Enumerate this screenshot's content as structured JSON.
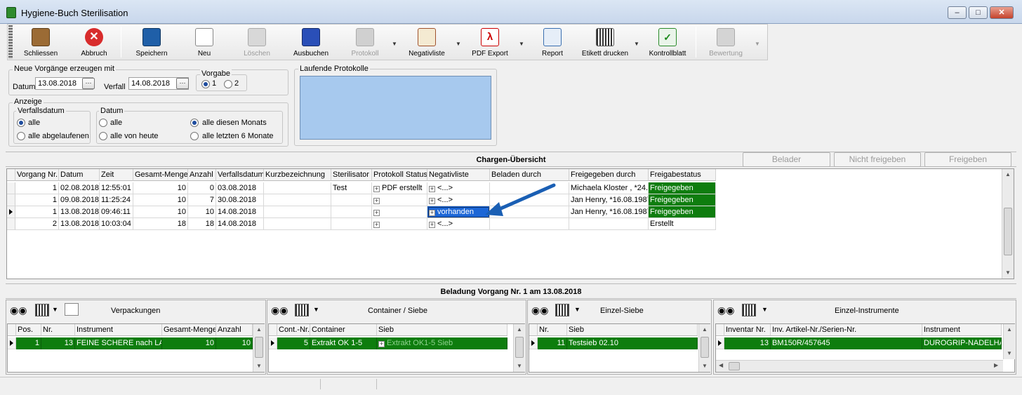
{
  "window": {
    "title": "Hygiene-Buch Sterilisation"
  },
  "toolbar": {
    "items": [
      {
        "label": "Schliessen",
        "icon": "door-exit-icon",
        "enabled": true
      },
      {
        "label": "Abbruch",
        "icon": "cancel-icon",
        "enabled": true
      },
      {
        "label": "Speichern",
        "icon": "save-disk-icon",
        "enabled": true
      },
      {
        "label": "Neu",
        "icon": "new-page-icon",
        "enabled": true
      },
      {
        "label": "Löschen",
        "icon": "trash-icon",
        "enabled": false
      },
      {
        "label": "Ausbuchen",
        "icon": "book-remove-icon",
        "enabled": true
      },
      {
        "label": "Protokoll",
        "icon": "protocol-icon",
        "enabled": false
      },
      {
        "label": "Negativliste",
        "icon": "clipboard-list-icon",
        "enabled": true
      },
      {
        "label": "PDF Export",
        "icon": "pdf-icon",
        "enabled": true
      },
      {
        "label": "Report",
        "icon": "report-icon",
        "enabled": true
      },
      {
        "label": "Etikett drucken",
        "icon": "label-printer-icon",
        "enabled": true
      },
      {
        "label": "Kontrollblatt",
        "icon": "checklist-icon",
        "enabled": true
      },
      {
        "label": "Bewertung",
        "icon": "rating-chart-icon",
        "enabled": false
      }
    ]
  },
  "create": {
    "group_label": "Neue Vorgänge erzeugen mit",
    "datum_label": "Datum",
    "datum_value": "13.08.2018",
    "verfall_label": "Verfall",
    "verfall_value": "14.08.2018",
    "vorgabe_label": "Vorgabe",
    "vorgabe_options": [
      "1",
      "2"
    ],
    "vorgabe_selected": "1"
  },
  "anzeige": {
    "group_label": "Anzeige",
    "verfall_group": "Verfallsdatum",
    "verfall_options": [
      "alle",
      "alle abgelaufenen"
    ],
    "datum_group": "Datum",
    "datum_options": [
      "alle",
      "alle von heute",
      "alle diesen Monats",
      "alle letzten 6 Monate"
    ],
    "datum_selected": "alle diesen Monats"
  },
  "protokolle": {
    "group_label": "Laufende Protokolle"
  },
  "chargen": {
    "title": "Chargen-Übersicht",
    "buttons": [
      "Belader",
      "Nicht freigeben",
      "Freigeben"
    ],
    "columns": [
      "Vorgang Nr.",
      "Datum",
      "Zeit",
      "Gesamt-Menge",
      "Anzahl",
      "Verfallsdatum",
      "Kurzbezeichnung",
      "Sterilisator",
      "Protokoll Status",
      "Negativliste",
      "Beladen durch",
      "Freigegeben durch",
      "Freigabestatus"
    ],
    "rows": [
      [
        "1",
        "02.08.2018",
        "12:55:01",
        "10",
        "0",
        "03.08.2018",
        "",
        "Test",
        "PDF erstellt",
        "<...>",
        "",
        "Michaela  Kloster , *24.",
        "Freigegeben"
      ],
      [
        "1",
        "09.08.2018",
        "11:25:24",
        "10",
        "7",
        "30.08.2018",
        "",
        "",
        "",
        "<...>",
        "",
        "Jan Henry, *16.08.1987",
        "Freigegeben"
      ],
      [
        "1",
        "13.08.2018",
        "09:46:11",
        "10",
        "10",
        "14.08.2018",
        "",
        "",
        "",
        "vorhanden",
        "",
        "Jan Henry, *16.08.1987",
        "Freigegeben"
      ],
      [
        "2",
        "13.08.2018",
        "10:03:04",
        "18",
        "18",
        "14.08.2018",
        "",
        "",
        "",
        "<...>",
        "",
        "",
        "Erstellt"
      ]
    ]
  },
  "beladung": {
    "title": "Beladung Vorgang Nr. 1 am 13.08.2018",
    "verpackungen": {
      "title": "Verpackungen",
      "columns": [
        "Pos.",
        "Nr.",
        "Instrument",
        "Gesamt-Menge",
        "Anzahl"
      ],
      "row": [
        "1",
        "13",
        "FEINE SCHERE nach LA",
        "10",
        "10"
      ]
    },
    "container": {
      "title": "Container / Siebe",
      "columns": [
        "Cont.-Nr.",
        "Container",
        "Sieb"
      ],
      "row": [
        "5",
        "Extrakt OK 1-5",
        "Extrakt OK1-5 Sieb"
      ]
    },
    "einzelsiebe": {
      "title": "Einzel-Siebe",
      "columns": [
        "Nr.",
        "Sieb"
      ],
      "row": [
        "11",
        "Testsieb 02.10"
      ]
    },
    "instrumente": {
      "title": "Einzel-Instrumente",
      "columns": [
        "Inventar Nr.",
        "Inv. Artikel-Nr./Serien-Nr.",
        "Instrument"
      ],
      "row": [
        "13",
        "BM150R/457645",
        "DUROGRIP-NADELHA"
      ]
    }
  },
  "colors": {
    "approved_green": "#0e7d0e",
    "selection_blue": "#1c66d6",
    "list_blue": "#a7c9ee",
    "arrow_blue": "#1a5fb4"
  }
}
